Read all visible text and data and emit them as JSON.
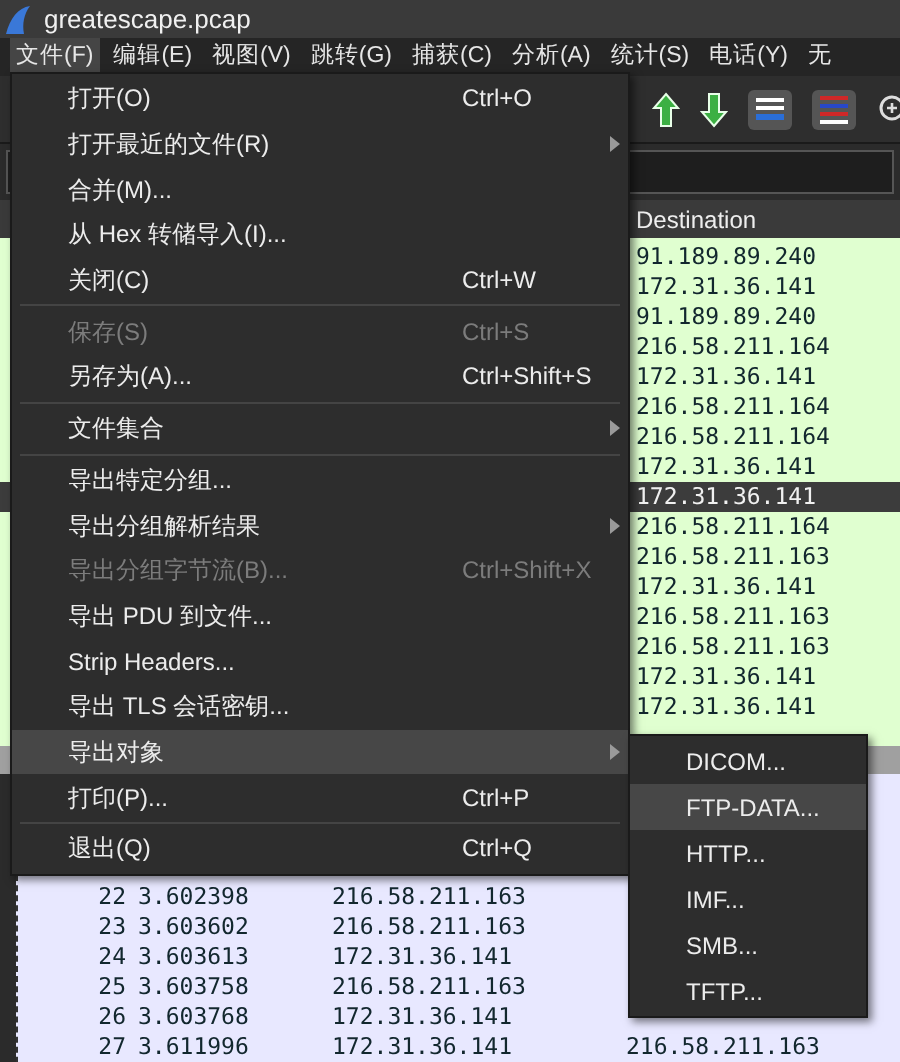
{
  "window": {
    "title": "greatescape.pcap"
  },
  "menubar": [
    {
      "label": "文件(F)",
      "selected": true
    },
    {
      "label": "编辑(E)",
      "selected": false
    },
    {
      "label": "视图(V)",
      "selected": false
    },
    {
      "label": "跳转(G)",
      "selected": false
    },
    {
      "label": "捕获(C)",
      "selected": false
    },
    {
      "label": "分析(A)",
      "selected": false
    },
    {
      "label": "统计(S)",
      "selected": false
    },
    {
      "label": "电话(Y)",
      "selected": false
    },
    {
      "label": "无",
      "selected": false
    }
  ],
  "packet_list": {
    "columns": [
      {
        "label": "Destination"
      }
    ],
    "rows": [
      {
        "destination": "91.189.89.240",
        "selected": false
      },
      {
        "destination": "172.31.36.141",
        "selected": false
      },
      {
        "destination": "91.189.89.240",
        "selected": false
      },
      {
        "destination": "216.58.211.164",
        "selected": false
      },
      {
        "destination": "172.31.36.141",
        "selected": false
      },
      {
        "destination": "216.58.211.164",
        "selected": false
      },
      {
        "destination": "216.58.211.164",
        "selected": false
      },
      {
        "destination": "172.31.36.141",
        "selected": false
      },
      {
        "destination": "172.31.36.141",
        "selected": true
      },
      {
        "destination": "216.58.211.164",
        "selected": false
      },
      {
        "destination": "216.58.211.163",
        "selected": false
      },
      {
        "destination": "172.31.36.141",
        "selected": false
      },
      {
        "destination": "216.58.211.163",
        "selected": false
      },
      {
        "destination": "216.58.211.163",
        "selected": false
      },
      {
        "destination": "172.31.36.141",
        "selected": false
      },
      {
        "destination": "172.31.36.141",
        "selected": false
      }
    ],
    "lower_rows": [
      {
        "no": "22",
        "time": "3.602398",
        "source": "216.58.211.163"
      },
      {
        "no": "23",
        "time": "3.603602",
        "source": "216.58.211.163"
      },
      {
        "no": "24",
        "time": "3.603613",
        "source": "172.31.36.141"
      },
      {
        "no": "25",
        "time": "3.603758",
        "source": "216.58.211.163"
      },
      {
        "no": "26",
        "time": "3.603768",
        "source": "172.31.36.141"
      },
      {
        "no": "27",
        "time": "3.611996",
        "source": "172.31.36.141",
        "destination": "216.58.211.163"
      }
    ]
  },
  "file_menu": [
    {
      "kind": "item",
      "label": "打开(O)",
      "shortcut": "Ctrl+O",
      "submenu": false,
      "disabled": false,
      "selected": false
    },
    {
      "kind": "item",
      "label": "打开最近的文件(R)",
      "submenu": true,
      "disabled": false,
      "selected": false
    },
    {
      "kind": "item",
      "label": "合并(M)...",
      "submenu": false,
      "disabled": false,
      "selected": false
    },
    {
      "kind": "item",
      "label": "从 Hex 转储导入(I)...",
      "submenu": false,
      "disabled": false,
      "selected": false
    },
    {
      "kind": "item",
      "label": "关闭(C)",
      "shortcut": "Ctrl+W",
      "submenu": false,
      "disabled": false,
      "selected": false
    },
    {
      "kind": "separator"
    },
    {
      "kind": "item",
      "label": "保存(S)",
      "shortcut": "Ctrl+S",
      "submenu": false,
      "disabled": true,
      "selected": false
    },
    {
      "kind": "item",
      "label": "另存为(A)...",
      "shortcut": "Ctrl+Shift+S",
      "submenu": false,
      "disabled": false,
      "selected": false
    },
    {
      "kind": "separator"
    },
    {
      "kind": "item",
      "label": "文件集合",
      "submenu": true,
      "disabled": false,
      "selected": false
    },
    {
      "kind": "separator"
    },
    {
      "kind": "item",
      "label": "导出特定分组...",
      "submenu": false,
      "disabled": false,
      "selected": false
    },
    {
      "kind": "item",
      "label": "导出分组解析结果",
      "submenu": true,
      "disabled": false,
      "selected": false
    },
    {
      "kind": "item",
      "label": "导出分组字节流(B)...",
      "shortcut": "Ctrl+Shift+X",
      "submenu": false,
      "disabled": true,
      "selected": false
    },
    {
      "kind": "item",
      "label": "导出 PDU 到文件...",
      "submenu": false,
      "disabled": false,
      "selected": false
    },
    {
      "kind": "item",
      "label": "Strip Headers...",
      "submenu": false,
      "disabled": false,
      "selected": false
    },
    {
      "kind": "item",
      "label": "导出 TLS 会话密钥...",
      "submenu": false,
      "disabled": false,
      "selected": false
    },
    {
      "kind": "item",
      "label": "导出对象",
      "submenu": true,
      "disabled": false,
      "selected": true
    },
    {
      "kind": "item",
      "label": "打印(P)...",
      "shortcut": "Ctrl+P",
      "submenu": false,
      "disabled": false,
      "selected": false
    },
    {
      "kind": "separator"
    },
    {
      "kind": "item",
      "label": "退出(Q)",
      "shortcut": "Ctrl+Q",
      "submenu": false,
      "disabled": false,
      "selected": false
    }
  ],
  "export_objects_menu": [
    {
      "label": "DICOM...",
      "selected": false
    },
    {
      "label": "FTP-DATA...",
      "selected": true
    },
    {
      "label": "HTTP...",
      "selected": false
    },
    {
      "label": "IMF...",
      "selected": false
    },
    {
      "label": "SMB...",
      "selected": false
    },
    {
      "label": "TFTP...",
      "selected": false
    }
  ]
}
